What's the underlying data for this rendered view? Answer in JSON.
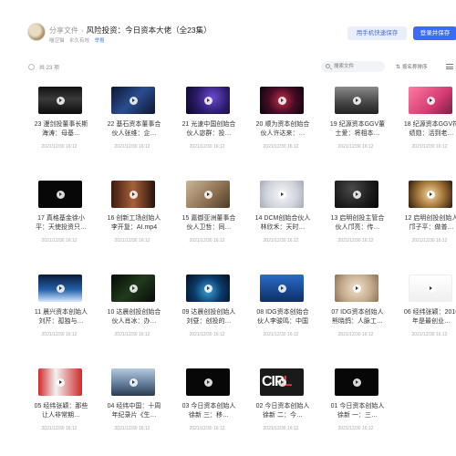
{
  "header": {
    "breadcrumb_root": "分享文件",
    "breadcrumb_sep": "›",
    "title": "风险投资：今日资本大佬（全23集）",
    "sharer": "喵涩猫",
    "validity": "永久有效",
    "report_label": "举报",
    "phone_save_label": "用手机快速保存",
    "login_save_label": "登录并保存"
  },
  "toolbar": {
    "count_label": "共 23 项",
    "search_placeholder": "搜索文件",
    "sort_label": "按名称排序"
  },
  "items": [
    {
      "name": "23 漫剑投董事长斯海涛：母基…",
      "date": "2021/12/30 16:12",
      "thumb": "city"
    },
    {
      "name": "22 基石资本董事合伙人张维：企…",
      "date": "2021/12/30 16:12",
      "thumb": "blue"
    },
    {
      "name": "21 光速中国创始合伙人宓群：投…",
      "date": "2021/12/30 16:12",
      "thumb": "purple"
    },
    {
      "name": "20 顺为资本创始合伙人许达来：…",
      "date": "2021/12/30 16:12",
      "thumb": "red"
    },
    {
      "name": "19 纪源资本GGV董士爱：将相本…",
      "date": "2021/12/30 16:12",
      "thumb": "grey"
    },
    {
      "name": "18 纪源资本GGV符绩勋：活到老…",
      "date": "2021/12/30 16:12",
      "thumb": "pink"
    },
    {
      "name": "17 真格基金徐小平：天使投资只…",
      "date": "2021/12/30 16:12",
      "thumb": "dark"
    },
    {
      "name": "16 创新工场创始人李开复：AI.mp4",
      "date": "2021/12/30 16:12",
      "thumb": "warm"
    },
    {
      "name": "15 嘉御亚洲董事合伙人卫哲：同…",
      "date": "2021/12/30 16:12",
      "thumb": "tan"
    },
    {
      "name": "14 DCM创始合伙人林欣禾：天时…",
      "date": "2021/12/30 16:12",
      "thumb": "blur"
    },
    {
      "name": "13 启明创投主管合伙人邝亮：传…",
      "date": "2021/12/30 16:12",
      "thumb": "night"
    },
    {
      "name": "12 启明创投创始人邝子平：做普…",
      "date": "2021/12/30 16:12",
      "thumb": "gold"
    },
    {
      "name": "11 晨兴资本创始人刘芹：孤独与…",
      "date": "2021/12/30 16:12",
      "thumb": "earth"
    },
    {
      "name": "10 达晨创投创始合伙人肖冰：办…",
      "date": "2021/12/30 16:12",
      "thumb": "neon"
    },
    {
      "name": "09 达晨创投创始人刘昼：创投的…",
      "date": "2021/12/30 16:12",
      "thumb": "globe"
    },
    {
      "name": "08 IDG资本创始合伙人李骏鸣：中国离…",
      "date": "2021/12/30 16:12",
      "thumb": "sky"
    },
    {
      "name": "07 IDG资本创始人熊晓鸽：人脉工…",
      "date": "2021/12/30 16:12",
      "thumb": "sand"
    },
    {
      "name": "06 经纬张颖：2016年是最创业…",
      "date": "2021/12/30 16:12",
      "thumb": "white"
    },
    {
      "name": "05 经纬张颖：那些让人非常期…",
      "date": "2021/12/30 16:12",
      "thumb": "redwhite"
    },
    {
      "name": "04 经纬中国：十周年纪录片《生…",
      "date": "2021/12/30 16:12",
      "thumb": "tower"
    },
    {
      "name": "03 今日资本创始人徐新 三：移…",
      "date": "2021/12/30 16:12",
      "thumb": "dark"
    },
    {
      "name": "02 今日资本创始人徐新 二：今…",
      "date": "2021/12/30 16:12",
      "thumb": "ciplus",
      "thumb_text": "CIPL",
      "thumb_text_accent": "L"
    },
    {
      "name": "01 今日资本创始人徐新 一：三…",
      "date": "2021/12/30 16:12",
      "thumb": "dark"
    }
  ]
}
